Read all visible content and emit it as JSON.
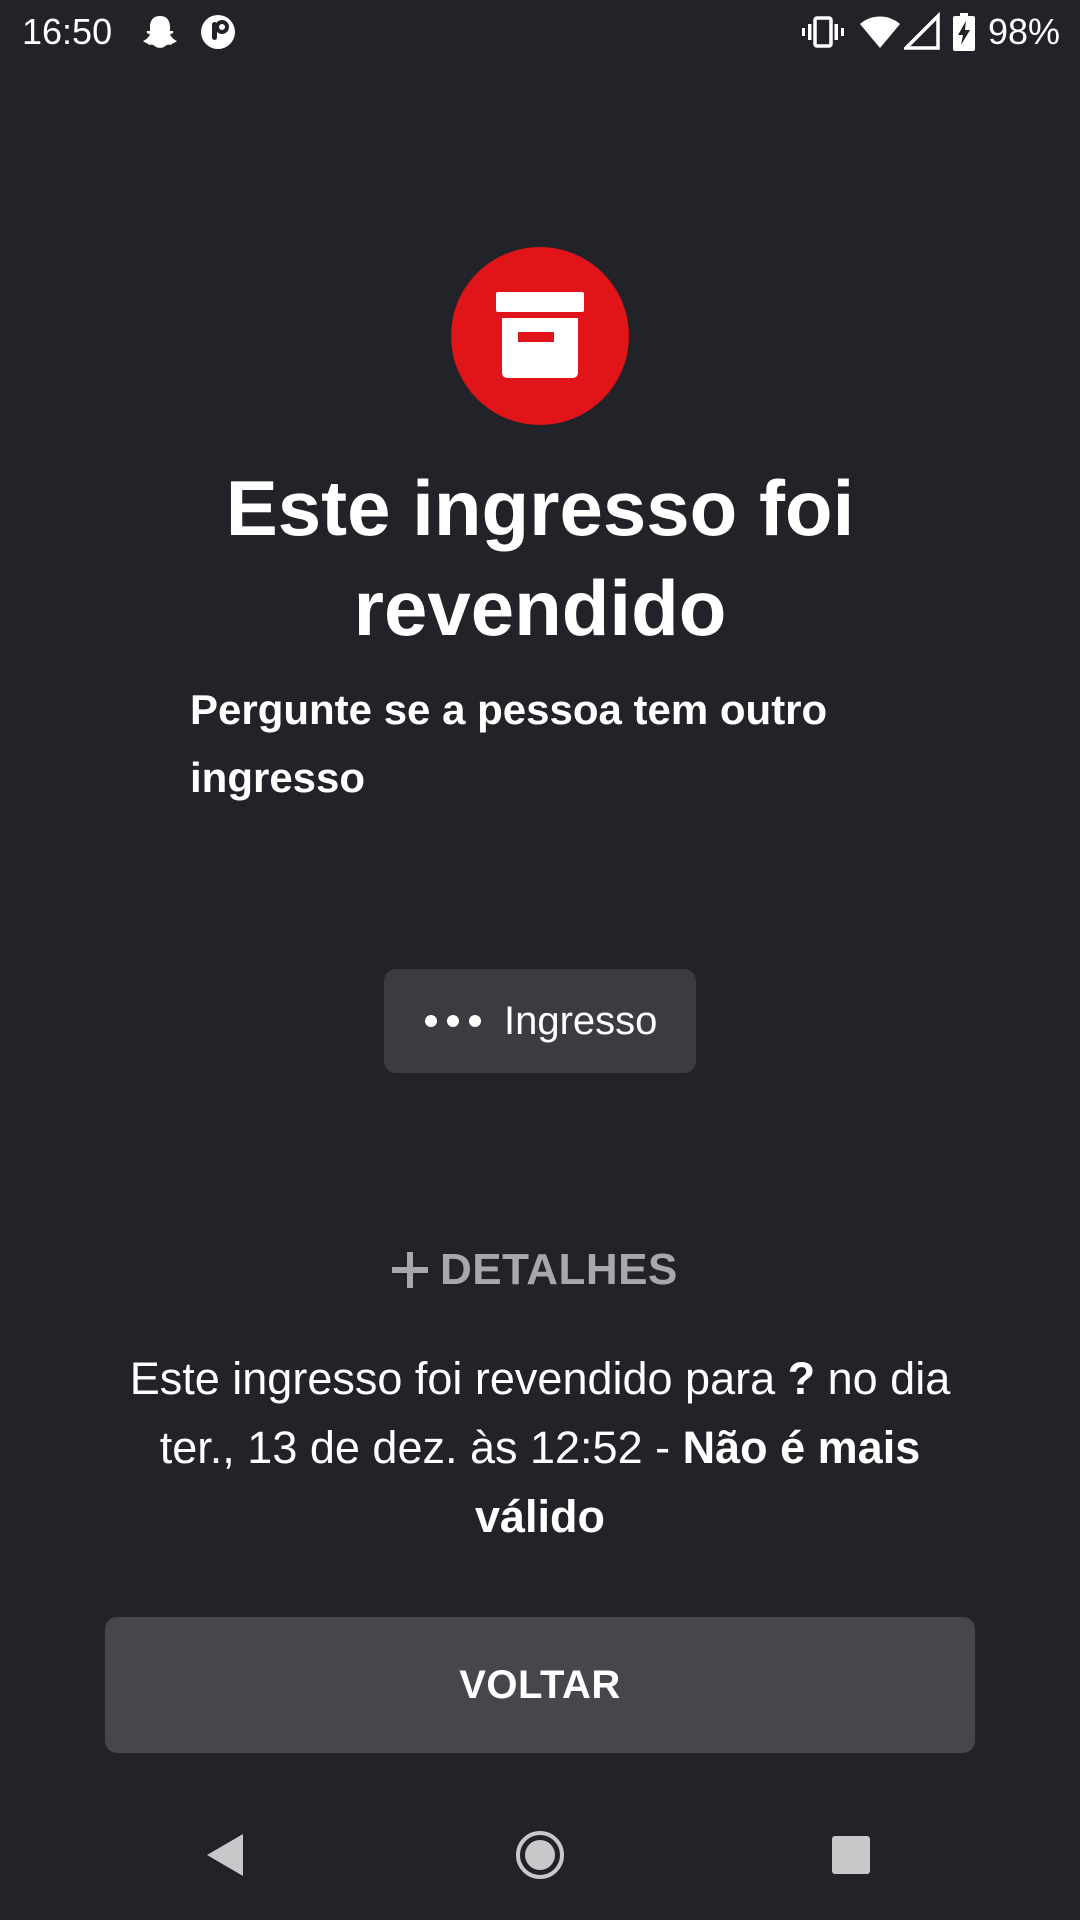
{
  "status_bar": {
    "time": "16:50",
    "battery_percent": "98%",
    "icons": [
      "snapchat-icon",
      "app-notification-icon",
      "vibrate-icon",
      "wifi-icon",
      "cell-signal-icon",
      "battery-charging-icon"
    ]
  },
  "hero": {
    "icon": "archive-box-icon",
    "circle_color": "#e1141a"
  },
  "title": "Este ingresso foi revendido",
  "subtitle": "Pergunte se a pessoa tem outro ingresso",
  "ticket_chip": {
    "icon": "more-dots-icon",
    "label": "Ingresso"
  },
  "details": {
    "icon": "plus-icon",
    "label": "DETALHES"
  },
  "info": {
    "part1": "Este ingresso foi revendido para ",
    "buyer": "?",
    "part2": " no dia ter., 13 de dez. às 12:52 - ",
    "status": "Não é mais válido"
  },
  "back_button": {
    "label": "VOLTAR"
  },
  "nav_bar": {
    "back": "back-triangle-icon",
    "home": "home-circle-icon",
    "recents": "recents-square-icon"
  },
  "colors": {
    "background": "#212328",
    "accent_red": "#e1141a",
    "chip_bg": "#3a3c42",
    "button_bg": "#45474c",
    "muted_text": "#a7a8ac"
  }
}
